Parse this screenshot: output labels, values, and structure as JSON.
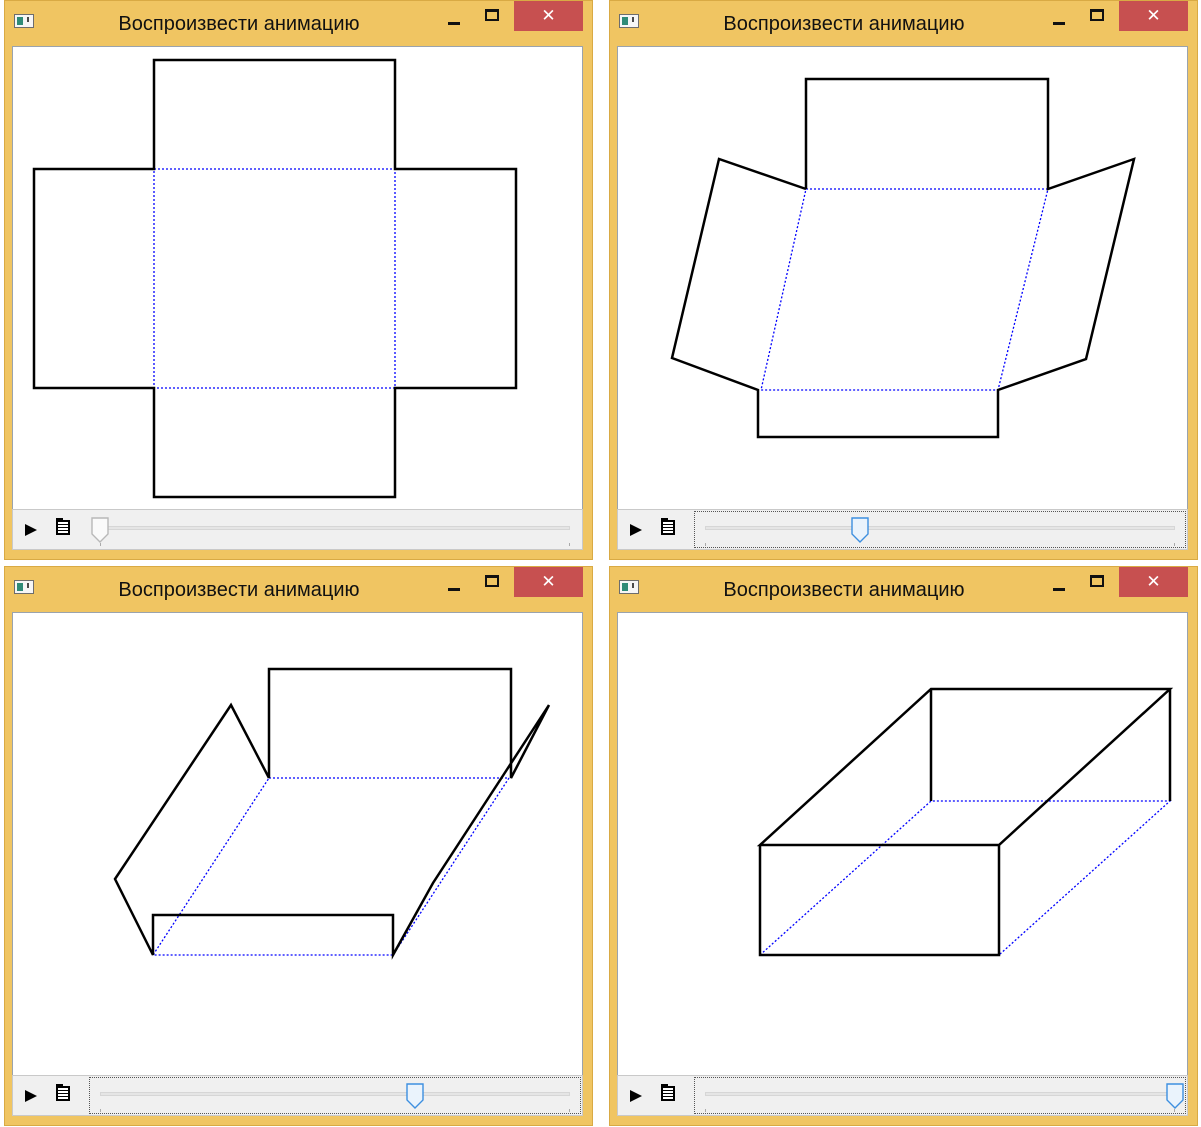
{
  "windows": [
    {
      "title": "Воспроизвести анимацию",
      "app_icon": "app-window-icon",
      "buttons": {
        "minimize": "minimize-icon",
        "maximize": "maximize-icon",
        "close": "✕"
      },
      "controls": {
        "play": "play-icon",
        "list": "playlist-icon"
      },
      "slider": {
        "value": 0.0,
        "active": false,
        "focused": false
      },
      "colors": {
        "thumb": "#b8b8b8",
        "fold_line": "#0000ff",
        "edge_line": "#000000"
      }
    },
    {
      "title": "Воспроизвести анимацию",
      "app_icon": "app-window-icon",
      "buttons": {
        "minimize": "minimize-icon",
        "maximize": "maximize-icon",
        "close": "✕"
      },
      "controls": {
        "play": "play-icon",
        "list": "playlist-icon"
      },
      "slider": {
        "value": 0.33,
        "active": true,
        "focused": true
      },
      "colors": {
        "thumb": "#3d8fe0",
        "fold_line": "#0000ff",
        "edge_line": "#000000"
      }
    },
    {
      "title": "Воспроизвести анимацию",
      "app_icon": "app-window-icon",
      "buttons": {
        "minimize": "minimize-icon",
        "maximize": "maximize-icon",
        "close": "✕"
      },
      "controls": {
        "play": "play-icon",
        "list": "playlist-icon"
      },
      "slider": {
        "value": 0.67,
        "active": true,
        "focused": true
      },
      "colors": {
        "thumb": "#3d8fe0",
        "fold_line": "#0000ff",
        "edge_line": "#000000"
      }
    },
    {
      "title": "Воспроизвести анимацию",
      "app_icon": "app-window-icon",
      "buttons": {
        "minimize": "minimize-icon",
        "maximize": "maximize-icon",
        "close": "✕"
      },
      "controls": {
        "play": "play-icon",
        "list": "playlist-icon"
      },
      "slider": {
        "value": 1.0,
        "active": true,
        "focused": true
      },
      "colors": {
        "thumb": "#3d8fe0",
        "fold_line": "#0000ff",
        "edge_line": "#000000"
      }
    }
  ]
}
